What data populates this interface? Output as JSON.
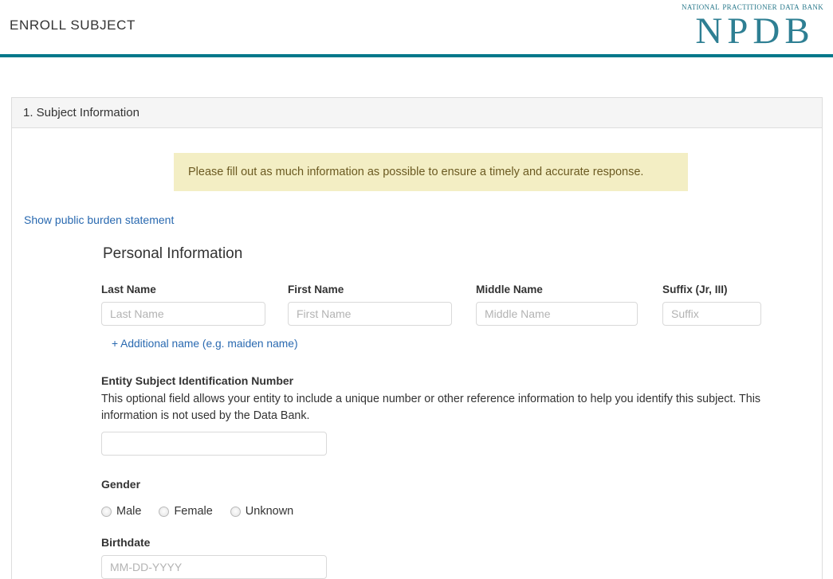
{
  "header": {
    "title": "ENROLL SUBJECT",
    "logo": {
      "tagline": "National Practitioner Data Bank",
      "acronym": "NPDB"
    },
    "accent_color": "#00788a"
  },
  "panel": {
    "heading": "1. Subject Information",
    "alert": "Please fill out as much information as possible to ensure a timely and accurate response.",
    "burden_link": "Show public burden statement",
    "section_subtitle": "Personal Information",
    "alert_bg": "#f3eec4",
    "link_color": "#2969b0"
  },
  "name_fields": [
    {
      "label": "Last Name",
      "placeholder": "Last Name",
      "value": ""
    },
    {
      "label": "First Name",
      "placeholder": "First Name",
      "value": ""
    },
    {
      "label": "Middle Name",
      "placeholder": "Middle Name",
      "value": ""
    },
    {
      "label": "Suffix (Jr, III)",
      "placeholder": "Suffix",
      "value": ""
    }
  ],
  "additional_name_link": "+ Additional name (e.g. maiden name)",
  "entity_id": {
    "label": "Entity Subject Identification Number",
    "help": "This optional field allows your entity to include a unique number or other reference information to help you identify this subject. This information is not used by the Data Bank.",
    "placeholder": "",
    "value": ""
  },
  "gender": {
    "label": "Gender",
    "options": [
      {
        "label": "Male",
        "selected": false
      },
      {
        "label": "Female",
        "selected": false
      },
      {
        "label": "Unknown",
        "selected": false
      }
    ]
  },
  "birthdate": {
    "label": "Birthdate",
    "placeholder": "MM-DD-YYYY",
    "value": ""
  }
}
